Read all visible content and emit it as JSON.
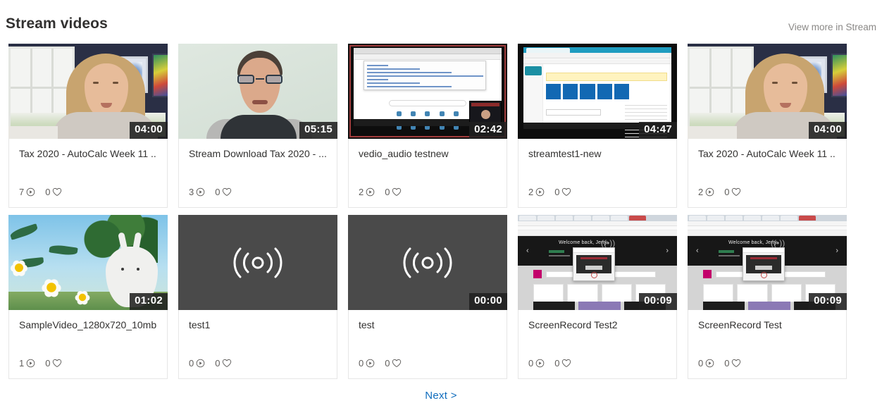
{
  "header": {
    "title": "Stream videos",
    "view_more_label": "View more in Stream"
  },
  "pagination": {
    "next_label": "Next >"
  },
  "icons": {
    "views": "play-icon",
    "likes": "heart-icon",
    "audio_only": "audio-wave-icon"
  },
  "colors": {
    "link": "#0f6cbd",
    "title": "#323130",
    "muted": "#8a8886",
    "card_border": "#e6e6e6",
    "duration_badge": "rgba(32,32,32,0.88)"
  },
  "videos": [
    {
      "title": "Tax 2020 - AutoCalc Week 11 ...",
      "duration": "04:00",
      "views": "7",
      "likes": "0",
      "thumbnail": "woman-webcam-navy-room"
    },
    {
      "title": "Stream Download Tax 2020 - ...",
      "duration": "05:15",
      "views": "3",
      "likes": "0",
      "thumbnail": "man-webcam-mint-wall"
    },
    {
      "title": "vedio_audio testnew",
      "duration": "02:42",
      "views": "2",
      "likes": "0",
      "thumbnail": "browser-screen-recording"
    },
    {
      "title": "streamtest1-new",
      "duration": "04:47",
      "views": "2",
      "likes": "0",
      "thumbnail": "sharepoint-screen-recording"
    },
    {
      "title": "Tax 2020 - AutoCalc Week 11 ...",
      "duration": "04:00",
      "views": "2",
      "likes": "0",
      "thumbnail": "woman-webcam-navy-room"
    },
    {
      "title": "SampleVideo_1280x720_10mb",
      "duration": "01:02",
      "views": "1",
      "likes": "0",
      "thumbnail": "big-buck-bunny"
    },
    {
      "title": "test1",
      "duration": "",
      "views": "0",
      "likes": "0",
      "thumbnail": "audio-only-placeholder"
    },
    {
      "title": "test",
      "duration": "00:00",
      "views": "0",
      "likes": "0",
      "thumbnail": "audio-only-placeholder"
    },
    {
      "title": "ScreenRecord Test2",
      "duration": "00:09",
      "views": "0",
      "likes": "0",
      "thumbnail": "welcome-back-jerry-recording"
    },
    {
      "title": "ScreenRecord Test",
      "duration": "00:09",
      "views": "0",
      "likes": "0",
      "thumbnail": "welcome-back-jerry-recording"
    }
  ]
}
